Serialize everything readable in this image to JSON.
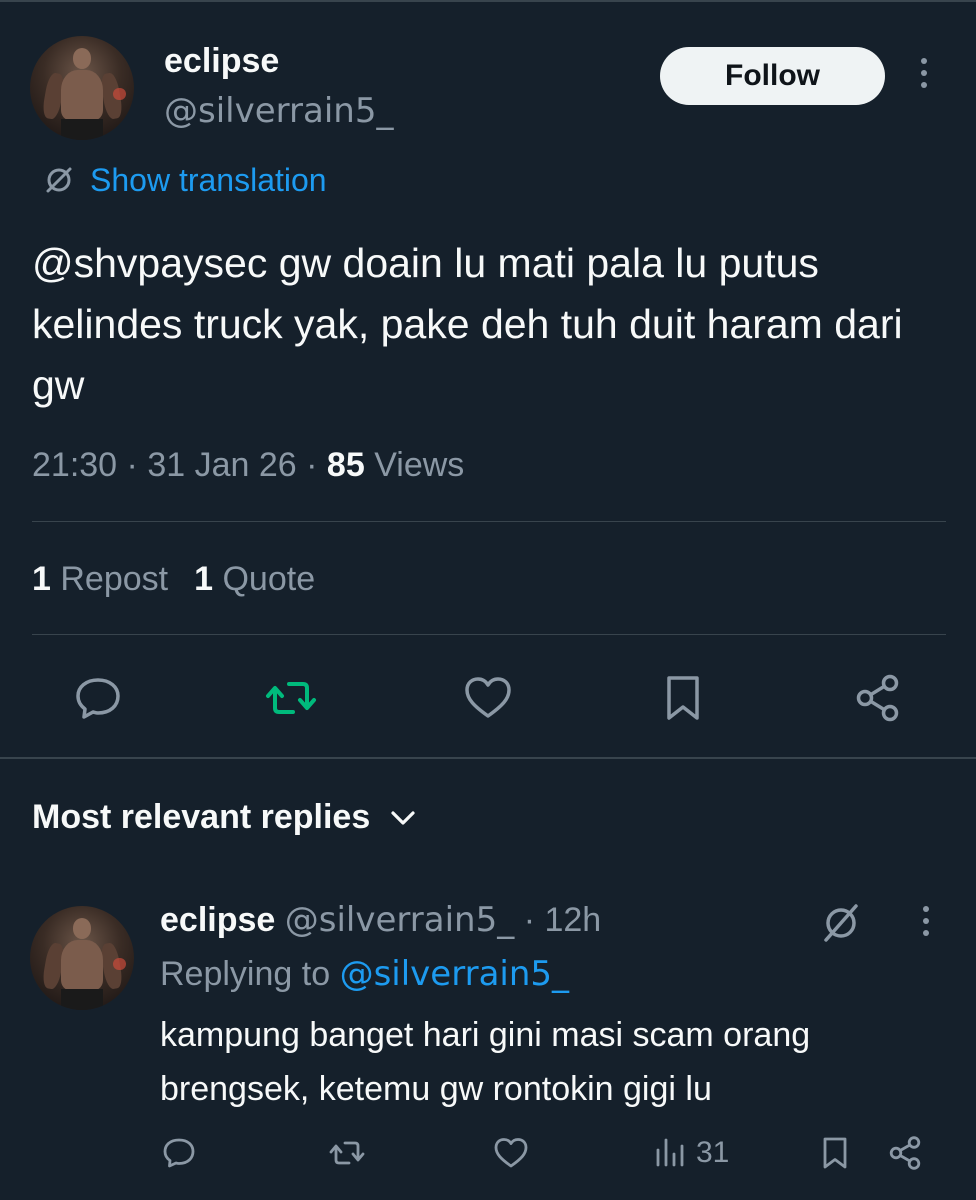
{
  "colors": {
    "background": "#15202b",
    "text_primary": "#f7f9f9",
    "text_secondary": "#8b98a5",
    "link": "#1d9bf0",
    "repost_active": "#00ba7c",
    "divider": "#38444d"
  },
  "post": {
    "author_name": "eclipse",
    "author_handle": "@silverrain5_",
    "follow_label": "Follow",
    "translation_label": "Show translation",
    "text": "@shvpaysec gw doain lu mati pala lu putus kelindes truck yak, pake deh tuh duit haram dari gw",
    "time": "21:30",
    "date": "31 Jan 26",
    "views_count": "85",
    "views_label": "Views",
    "reposts_count": "1",
    "reposts_label": "Repost",
    "quotes_count": "1",
    "quotes_label": "Quote",
    "repost_active": true
  },
  "replies_section": {
    "title": "Most relevant replies"
  },
  "reply": {
    "author_name": "eclipse",
    "author_handle": "@silverrain5_",
    "time": "· 12h",
    "replying_prefix": "Replying to",
    "replying_to": "@silverrain5_",
    "text": "kampung banget hari gini masi scam orang brengsek, ketemu gw rontokin gigi lu",
    "views_count": "31"
  },
  "icons": {
    "translate": "translate-icon",
    "reply": "reply-icon",
    "repost": "repost-icon",
    "like": "heart-icon",
    "bookmark": "bookmark-icon",
    "share": "share-icon",
    "chevron": "chevron-down-icon",
    "grok": "grok-icon",
    "analytics": "analytics-icon",
    "more": "more-icon"
  }
}
